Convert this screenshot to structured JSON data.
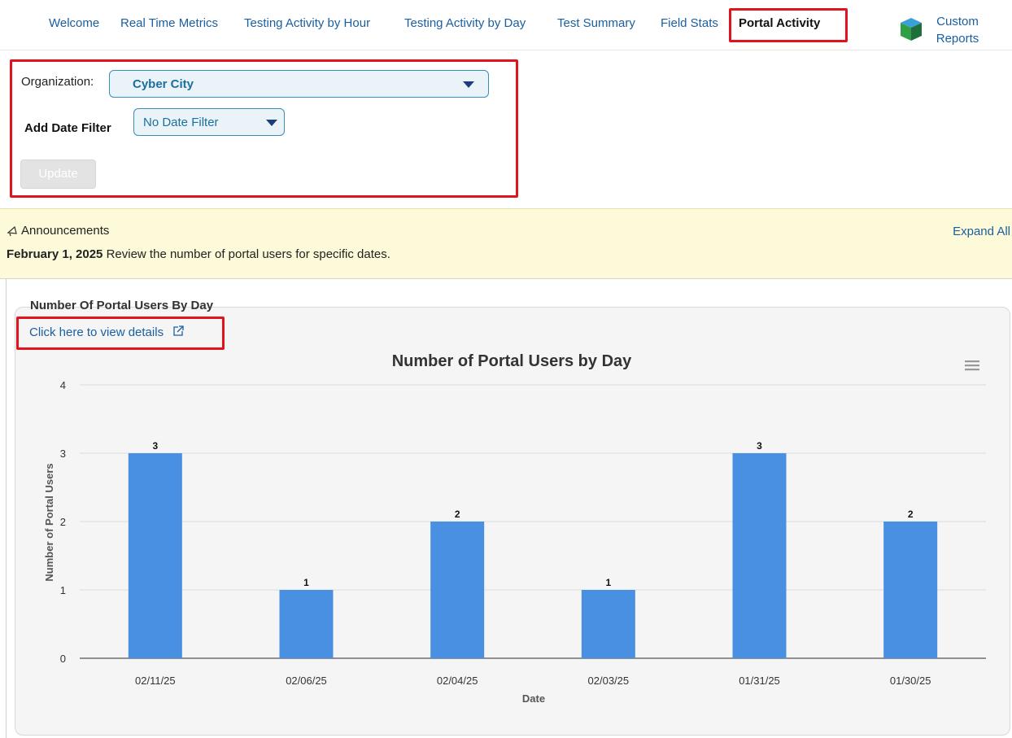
{
  "nav": {
    "items": [
      {
        "label": "Welcome"
      },
      {
        "label": "Real Time Metrics"
      },
      {
        "label": "Testing Activity by Hour"
      },
      {
        "label": "Testing Activity by Day"
      },
      {
        "label": "Test Summary"
      },
      {
        "label": "Field Stats"
      },
      {
        "label": "Portal Activity",
        "active": true
      }
    ],
    "custom_reports": {
      "line1": "Custom",
      "line2": "Reports",
      "icon": "cube-icon"
    }
  },
  "filters": {
    "org_label": "Organization:",
    "org_value": "Cyber City",
    "date_label": "Add Date Filter",
    "date_value": "No Date Filter",
    "update_label": "Update"
  },
  "announcements": {
    "heading": "Announcements",
    "icon": "megaphone-icon",
    "expand_label": "Expand All",
    "items": [
      {
        "date": "February 1, 2025",
        "text": "Review the number of portal users for specific dates."
      }
    ]
  },
  "chart_section": {
    "heading": "Number Of Portal Users By Day",
    "details_link": "Click here to view details",
    "menu_icon": "hamburger-menu-icon"
  },
  "chart_data": {
    "type": "bar",
    "title": "Number of Portal Users by Day",
    "xlabel": "Date",
    "ylabel": "Number of Portal Users",
    "categories": [
      "02/11/25",
      "02/06/25",
      "02/04/25",
      "02/03/25",
      "01/31/25",
      "01/30/25"
    ],
    "values": [
      3,
      1,
      2,
      1,
      3,
      2
    ],
    "ylim": [
      0,
      4
    ],
    "yticks": [
      0,
      1,
      2,
      3,
      4
    ],
    "grid": true,
    "data_labels": true,
    "bar_color": "#4a90e2"
  },
  "colors": {
    "accent": "#1a5fa0",
    "highlight_border": "#e0141e",
    "announce_bg": "#fcfad9"
  }
}
